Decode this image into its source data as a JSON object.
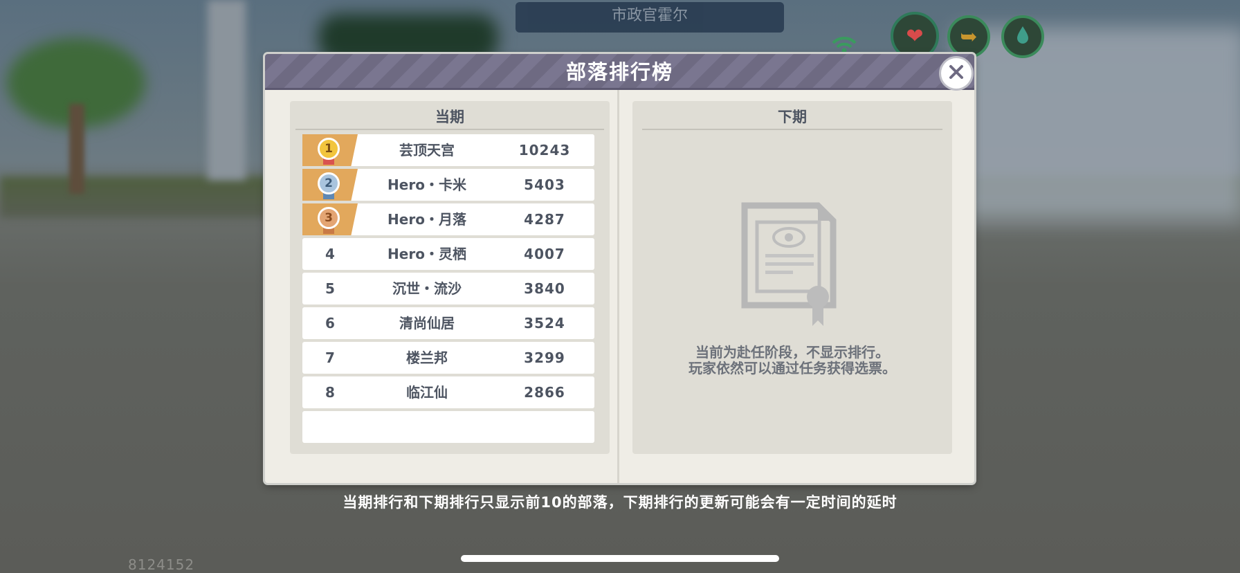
{
  "npc": {
    "title": "市政官霍尔"
  },
  "hud": {
    "wifi_icon": "wifi-signal-icon",
    "icons": [
      {
        "name": "heart-icon",
        "glyph": "❤",
        "color": "#d94b4b"
      },
      {
        "name": "share-arrow-icon",
        "glyph": "➥",
        "color": "#c8962e"
      },
      {
        "name": "water-drop-icon",
        "glyph": "💧",
        "color": "#3f9d8a"
      }
    ]
  },
  "modal": {
    "title": "部落排行榜",
    "close_icon": "close-icon",
    "current": {
      "header": "当期",
      "rows": [
        {
          "rank": "1",
          "name": "芸顶天宫",
          "score": "10243",
          "medal": "gold"
        },
        {
          "rank": "2",
          "name": "Hero・卡米",
          "score": "5403",
          "medal": "silver"
        },
        {
          "rank": "3",
          "name": "Hero・月落",
          "score": "4287",
          "medal": "bronze"
        },
        {
          "rank": "4",
          "name": "Hero・灵栖",
          "score": "4007"
        },
        {
          "rank": "5",
          "name": "沉世・流沙",
          "score": "3840"
        },
        {
          "rank": "6",
          "name": "清尚仙居",
          "score": "3524"
        },
        {
          "rank": "7",
          "name": "楼兰邦",
          "score": "3299"
        },
        {
          "rank": "8",
          "name": "临江仙",
          "score": "2866"
        }
      ]
    },
    "next": {
      "header": "下期",
      "placeholder_icon": "certificate-scroll-icon",
      "message_line1": "当前为赴任阶段，不显示排行。",
      "message_line2": "玩家依然可以通过任务获得选票。"
    }
  },
  "footer": {
    "note": "当期排行和下期排行只显示前10的部落，下期排行的更新可能会有一定时间的延时",
    "uid": "8124152"
  },
  "colors": {
    "header_purple": "#6e6a82",
    "gold_badge": "#e2a85c",
    "text_dark": "#4d5461"
  }
}
